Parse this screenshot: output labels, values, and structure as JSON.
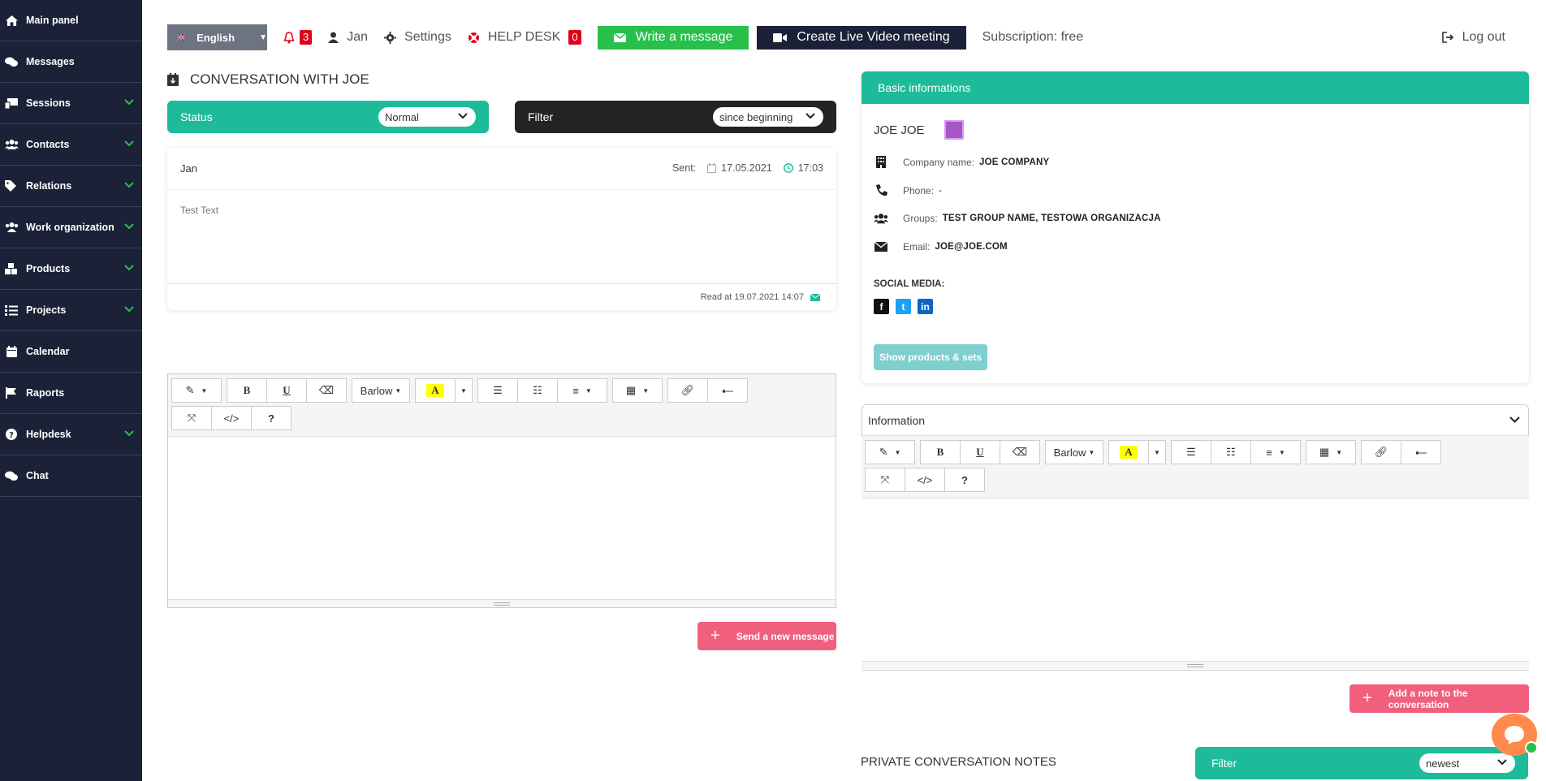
{
  "sidebar": {
    "items": [
      {
        "label": "Main panel",
        "icon": "home-icon",
        "expandable": false
      },
      {
        "label": "Messages",
        "icon": "comments-icon",
        "expandable": false
      },
      {
        "label": "Sessions",
        "icon": "sessions-icon",
        "expandable": true
      },
      {
        "label": "Contacts",
        "icon": "users-icon",
        "expandable": true
      },
      {
        "label": "Relations",
        "icon": "tags-icon",
        "expandable": true
      },
      {
        "label": "Work organization",
        "icon": "team-icon",
        "expandable": true
      },
      {
        "label": "Products",
        "icon": "boxes-icon",
        "expandable": true
      },
      {
        "label": "Projects",
        "icon": "tasks-icon",
        "expandable": true
      },
      {
        "label": "Calendar",
        "icon": "calendar-icon",
        "expandable": false
      },
      {
        "label": "Raports",
        "icon": "flag-icon",
        "expandable": false
      },
      {
        "label": "Helpdesk",
        "icon": "question-icon",
        "expandable": true
      },
      {
        "label": "Chat",
        "icon": "chat-icon",
        "expandable": false
      }
    ]
  },
  "topbar": {
    "language": "English",
    "notifications_count": "3",
    "user": "Jan",
    "settings": "Settings",
    "helpdesk": "HELP DESK",
    "helpdesk_count": "0",
    "write_message": "Write a message",
    "create_meeting": "Create Live Video meeting",
    "subscription": "Subscription: free",
    "logout": "Log out"
  },
  "conversation": {
    "title": "CONVERSATION WITH JOE",
    "status_label": "Status",
    "status_value": "Normal",
    "filter_label": "Filter",
    "filter_value": "since beginning",
    "message": {
      "author": "Jan",
      "sent_label": "Sent:",
      "date": "17.05.2021",
      "time": "17:03",
      "body": "Test Text",
      "read_at": "Read at 19.07.2021 14:07"
    },
    "send_button": "Send a new message"
  },
  "editor": {
    "font": "Barlow",
    "bold": "B",
    "underline": "U",
    "highlight": "A",
    "code": "</>",
    "help": "?"
  },
  "basic": {
    "header": "Basic informations",
    "name": "JOE JOE",
    "company_label": "Company name:",
    "company": "JOE COMPANY",
    "phone_label": "Phone:",
    "phone": "-",
    "groups_label": "Groups:",
    "groups": "TEST GROUP NAME, TESTOWA ORGANIZACJA",
    "email_label": "Email:",
    "email": "JOE@JOE.COM",
    "social_label": "SOCIAL MEDIA:",
    "show_products": "Show products & sets"
  },
  "information": {
    "header": "Information",
    "add_note": "Add a note to the conversation"
  },
  "notes": {
    "title": "PRIVATE CONVERSATION NOTES",
    "filter_label": "Filter",
    "filter_value": "newest"
  },
  "colors": {
    "sidebar": "#1b2136",
    "teal": "#1dbb99",
    "pink": "#f0607d",
    "green": "#27c04b",
    "badge_red": "#e0001b"
  }
}
